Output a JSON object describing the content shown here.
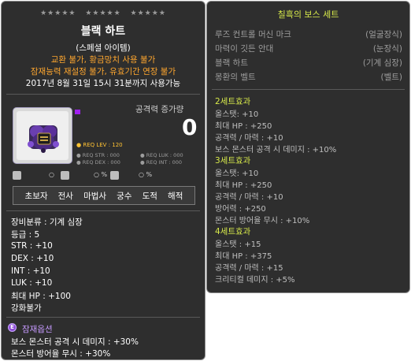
{
  "item": {
    "stars": [
      "★★★★★",
      "★★★★★",
      "★★★★★"
    ],
    "name": "블랙 하트",
    "type": "(스페셜 아이템)",
    "restriction1": "교환 불가, 황금망치 사용 불가",
    "restriction2": "잠재능력 재설정 불가, 유효기간 연장 불가",
    "expiry": "2017년 8월 31일 15시 31분까지 사용가능",
    "attack_increase_label": "공격력 증가량",
    "attack_increase_value": "0",
    "req_lev": "● REQ LEV : 120",
    "req_str": "● REQ STR : 000",
    "req_luk": "● REQ LUK : 000",
    "req_dex": "● REQ DEX : 000",
    "req_int": "● REQ INT : 000",
    "mini": [
      "○",
      "○ %",
      "○ %"
    ],
    "jobs": [
      "초보자",
      "전사",
      "마법사",
      "궁수",
      "도적",
      "해적"
    ],
    "stats": [
      "장비분류 : 기계 심장",
      "등급 : 5",
      "STR : +10",
      "DEX : +10",
      "INT : +10",
      "LUK : +10",
      "최대 HP : +100",
      "강화불가"
    ],
    "potential_icon": "E",
    "potential_title": "잠재옵션",
    "potential_lines": [
      "보스 몬스터 공격 시 데미지 : +30%",
      "몬스터 방어율 무시 : +30%"
    ]
  },
  "set": {
    "title": "칠흑의 보스 세트",
    "items": [
      {
        "name": "루즈 컨트롤 머신 마크",
        "slot": "(얼굴장식)"
      },
      {
        "name": "마력이 깃든 안대",
        "slot": "(눈장식)"
      },
      {
        "name": "블랙 하트",
        "slot": "(기계 심장)"
      },
      {
        "name": "몽환의 벨트",
        "slot": "(벨트)"
      }
    ],
    "effects": [
      {
        "title": "2세트효과",
        "lines": [
          "올스탯: +10",
          "최대 HP : +250",
          "공격력 / 마력 : +10",
          "보스 몬스터 공격 시 데미지 : +10%"
        ]
      },
      {
        "title": "3세트효과",
        "lines": [
          "올스탯: +10",
          "최대 HP : +250",
          "공격력 / 마력 : +10",
          "방어력 : +250",
          "몬스터 방어율 무시 : +10%"
        ]
      },
      {
        "title": "4세트효과",
        "lines": [
          "올스탯 : +15",
          "최대 HP : +375",
          "공격력 / 마력 : +15",
          "크리티컬 데미지 : +5%"
        ]
      }
    ]
  },
  "colors": {
    "panel": "#2e2e2e",
    "orange": "#ffa72e",
    "yellow_green": "#d7e94a",
    "purple": "#a020f0"
  }
}
